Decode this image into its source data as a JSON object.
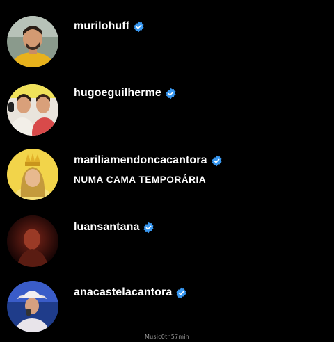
{
  "accounts": [
    {
      "username": "murilohuff",
      "verified": true,
      "avatar": "avatar-man-yellow-shirt",
      "caption": ""
    },
    {
      "username": "hugoeguilherme",
      "verified": true,
      "avatar": "avatar-duo-singers",
      "caption": ""
    },
    {
      "username": "mariliamendoncacantora",
      "verified": true,
      "avatar": "avatar-woman-crown",
      "caption": "NUMA CAMA TEMPORÁRIA"
    },
    {
      "username": "luansantana",
      "verified": true,
      "avatar": "avatar-dark-red-figure",
      "caption": ""
    },
    {
      "username": "anacastelacantora",
      "verified": true,
      "avatar": "avatar-woman-cowboy-hat",
      "caption": ""
    }
  ],
  "watermark": "Music0th57min",
  "colors": {
    "background": "#000000",
    "text": "#ffffff",
    "verified_badge": "#3897f0"
  }
}
